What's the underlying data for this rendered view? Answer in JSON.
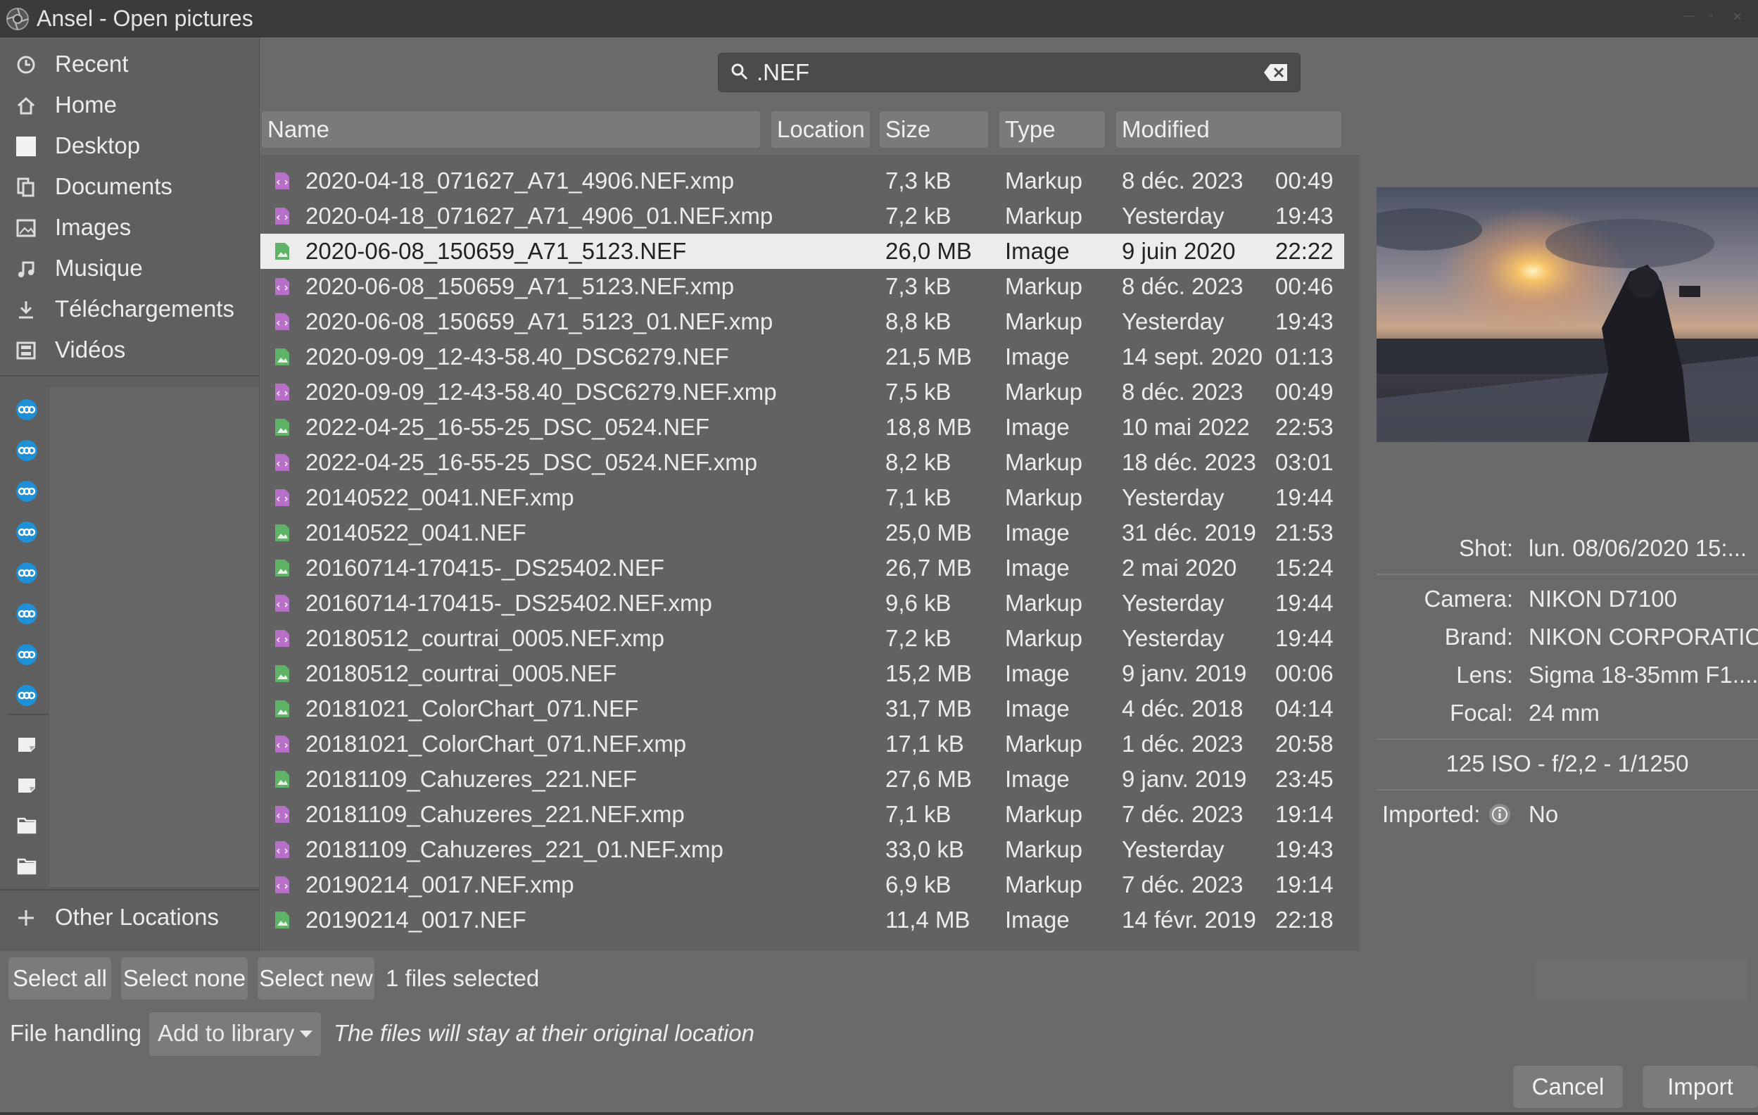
{
  "window": {
    "title": "Ansel - Open pictures"
  },
  "sidebar": {
    "places": [
      {
        "label": "Recent",
        "icon": "clock-icon"
      },
      {
        "label": "Home",
        "icon": "home-icon"
      },
      {
        "label": "Desktop",
        "icon": "desktop-icon"
      },
      {
        "label": "Documents",
        "icon": "documents-icon"
      },
      {
        "label": "Images",
        "icon": "images-icon"
      },
      {
        "label": "Musique",
        "icon": "music-icon"
      },
      {
        "label": "Téléchargements",
        "icon": "download-icon"
      },
      {
        "label": "Vidéos",
        "icon": "video-icon"
      }
    ],
    "network_bookmarks_icon": "network-drive-icon",
    "local_bookmarks": [
      "drive-icon",
      "drive-icon",
      "folder-icon",
      "folder-icon"
    ],
    "other_locations": "Other Locations"
  },
  "search": {
    "value": ".NEF"
  },
  "columns": {
    "name": "Name",
    "location": "Location",
    "size": "Size",
    "type": "Type",
    "modified": "Modified"
  },
  "files": [
    {
      "name": "2020-04-18_071627_A71_4906.NEF.xmp",
      "size": "7,3 kB",
      "type": "Markup",
      "date": "8 déc. 2023",
      "time": "00:49",
      "kind": "xmp"
    },
    {
      "name": "2020-04-18_071627_A71_4906_01.NEF.xmp",
      "size": "7,2 kB",
      "type": "Markup",
      "date": "Yesterday",
      "time": "19:43",
      "kind": "xmp"
    },
    {
      "name": "2020-06-08_150659_A71_5123.NEF",
      "size": "26,0 MB",
      "type": "Image",
      "date": "9 juin 2020",
      "time": "22:22",
      "kind": "img",
      "selected": true
    },
    {
      "name": "2020-06-08_150659_A71_5123.NEF.xmp",
      "size": "7,3 kB",
      "type": "Markup",
      "date": "8 déc. 2023",
      "time": "00:46",
      "kind": "xmp"
    },
    {
      "name": "2020-06-08_150659_A71_5123_01.NEF.xmp",
      "size": "8,8 kB",
      "type": "Markup",
      "date": "Yesterday",
      "time": "19:43",
      "kind": "xmp"
    },
    {
      "name": "2020-09-09_12-43-58.40_DSC6279.NEF",
      "size": "21,5 MB",
      "type": "Image",
      "date": "14 sept. 2020",
      "time": "01:13",
      "kind": "img"
    },
    {
      "name": "2020-09-09_12-43-58.40_DSC6279.NEF.xmp",
      "size": "7,5 kB",
      "type": "Markup",
      "date": "8 déc. 2023",
      "time": "00:49",
      "kind": "xmp"
    },
    {
      "name": "2022-04-25_16-55-25_DSC_0524.NEF",
      "size": "18,8 MB",
      "type": "Image",
      "date": "10 mai 2022",
      "time": "22:53",
      "kind": "img"
    },
    {
      "name": "2022-04-25_16-55-25_DSC_0524.NEF.xmp",
      "size": "8,2 kB",
      "type": "Markup",
      "date": "18 déc. 2023",
      "time": "03:01",
      "kind": "xmp"
    },
    {
      "name": "20140522_0041.NEF.xmp",
      "size": "7,1 kB",
      "type": "Markup",
      "date": "Yesterday",
      "time": "19:44",
      "kind": "xmp"
    },
    {
      "name": "20140522_0041.NEF",
      "size": "25,0 MB",
      "type": "Image",
      "date": "31 déc. 2019",
      "time": "21:53",
      "kind": "img"
    },
    {
      "name": "20160714-170415-_DS25402.NEF",
      "size": "26,7 MB",
      "type": "Image",
      "date": "2 mai 2020",
      "time": "15:24",
      "kind": "img"
    },
    {
      "name": "20160714-170415-_DS25402.NEF.xmp",
      "size": "9,6 kB",
      "type": "Markup",
      "date": "Yesterday",
      "time": "19:44",
      "kind": "xmp"
    },
    {
      "name": "20180512_courtrai_0005.NEF.xmp",
      "size": "7,2 kB",
      "type": "Markup",
      "date": "Yesterday",
      "time": "19:44",
      "kind": "xmp"
    },
    {
      "name": "20180512_courtrai_0005.NEF",
      "size": "15,2 MB",
      "type": "Image",
      "date": "9 janv. 2019",
      "time": "00:06",
      "kind": "img"
    },
    {
      "name": "20181021_ColorChart_071.NEF",
      "size": "31,7 MB",
      "type": "Image",
      "date": "4 déc. 2018",
      "time": "04:14",
      "kind": "img"
    },
    {
      "name": "20181021_ColorChart_071.NEF.xmp",
      "size": "17,1 kB",
      "type": "Markup",
      "date": "1 déc. 2023",
      "time": "20:58",
      "kind": "xmp"
    },
    {
      "name": "20181109_Cahuzeres_221.NEF",
      "size": "27,6 MB",
      "type": "Image",
      "date": "9 janv. 2019",
      "time": "23:45",
      "kind": "img"
    },
    {
      "name": "20181109_Cahuzeres_221.NEF.xmp",
      "size": "7,1 kB",
      "type": "Markup",
      "date": "7 déc. 2023",
      "time": "19:14",
      "kind": "xmp"
    },
    {
      "name": "20181109_Cahuzeres_221_01.NEF.xmp",
      "size": "33,0 kB",
      "type": "Markup",
      "date": "Yesterday",
      "time": "19:43",
      "kind": "xmp"
    },
    {
      "name": "20190214_0017.NEF.xmp",
      "size": "6,9 kB",
      "type": "Markup",
      "date": "7 déc. 2023",
      "time": "19:14",
      "kind": "xmp"
    },
    {
      "name": "20190214_0017.NEF",
      "size": "11,4 MB",
      "type": "Image",
      "date": "14 févr. 2019",
      "time": "22:18",
      "kind": "img"
    }
  ],
  "metadata": {
    "shot_label": "Shot:",
    "shot_value": "lun. 08/06/2020 15:...",
    "camera_label": "Camera:",
    "camera_value": "NIKON D7100",
    "brand_label": "Brand:",
    "brand_value": "NIKON CORPORATIO...",
    "lens_label": "Lens:",
    "lens_value": "Sigma 18-35mm F1....",
    "focal_label": "Focal:",
    "focal_value": "24 mm",
    "exposure": "125 ISO - f/2,2 - 1/1250",
    "imported_label": "Imported:",
    "imported_value": "No"
  },
  "selection": {
    "select_all": "Select all",
    "select_none": "Select none",
    "select_new": "Select new",
    "count_text": "1 files selected"
  },
  "handling": {
    "label": "File handling",
    "mode": "Add to library",
    "note": "The files will stay at their original location"
  },
  "actions": {
    "cancel": "Cancel",
    "import": "Import"
  },
  "colors": {
    "xmp_icon": "#b86fc8",
    "img_icon": "#5fb366",
    "bookmark_icon": "#1f8fd6"
  }
}
